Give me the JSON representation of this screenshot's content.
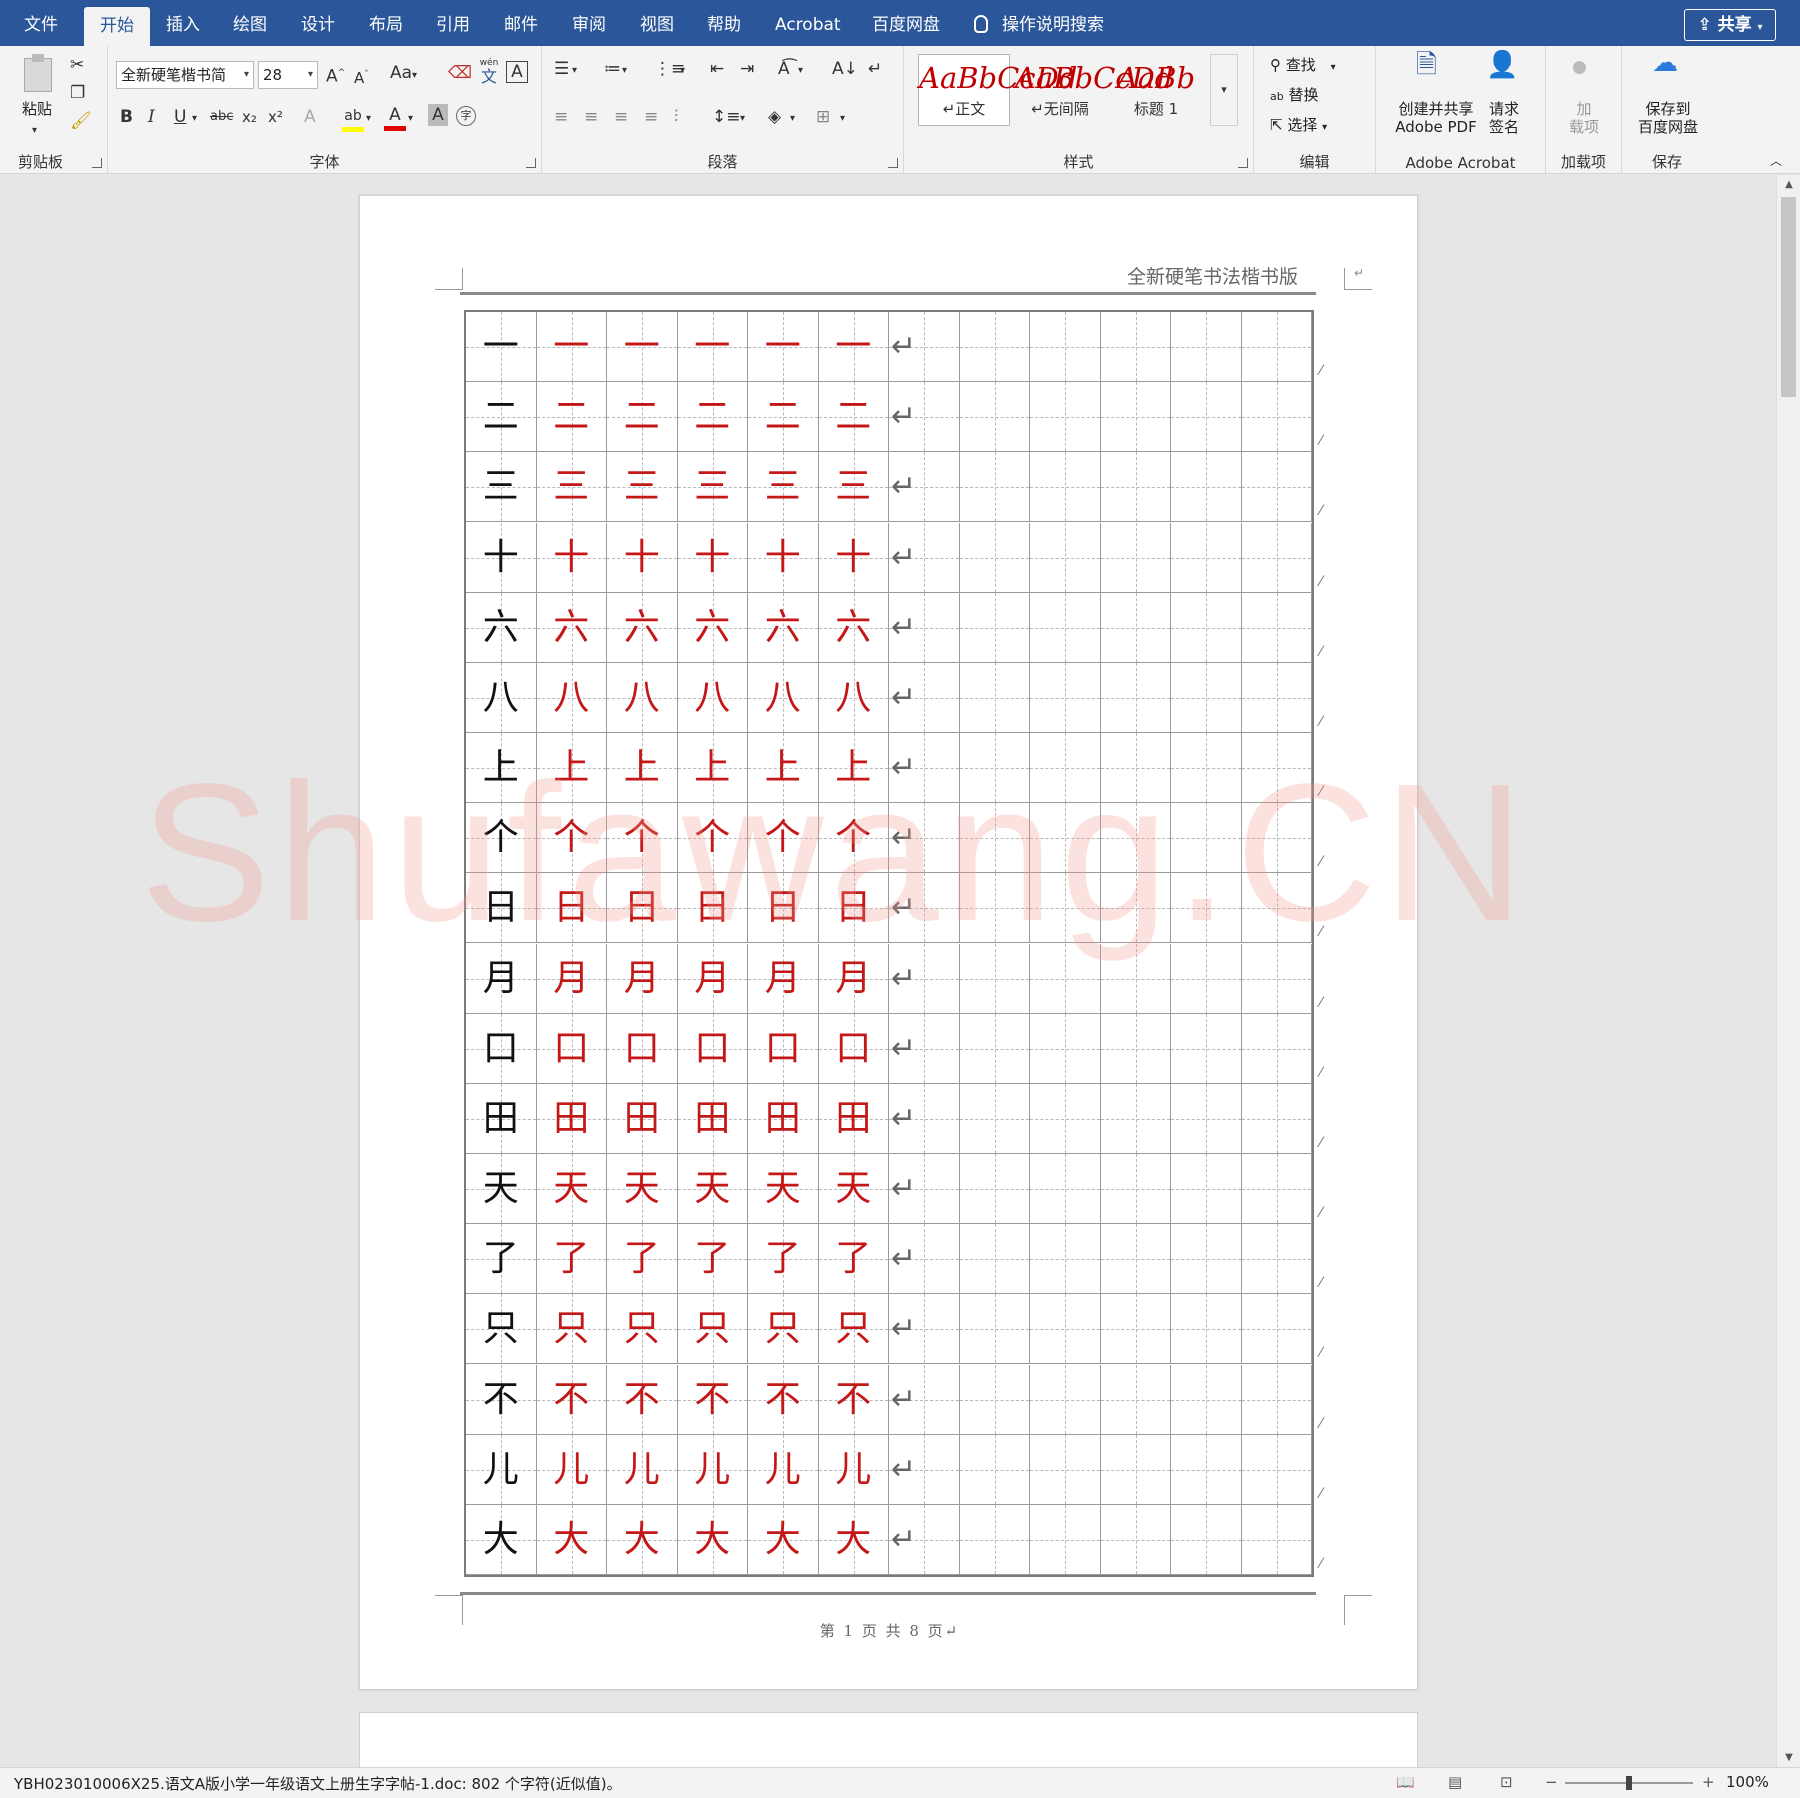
{
  "tabs": [
    "文件",
    "开始",
    "插入",
    "绘图",
    "设计",
    "布局",
    "引用",
    "邮件",
    "审阅",
    "视图",
    "帮助",
    "Acrobat",
    "百度网盘"
  ],
  "tell_me": "操作说明搜索",
  "share_label": "共享",
  "ribbon": {
    "clipboard": {
      "label": "剪贴板",
      "paste": "粘贴"
    },
    "font": {
      "label": "字体",
      "font_name": "全新硬笔楷书简",
      "font_size": "28",
      "case_label": "Aa",
      "pinyin_top": "wén",
      "pinyin_char": "文",
      "bold": "B",
      "italic": "I",
      "underline": "U",
      "strike": "abc",
      "sub": "x₂",
      "sup": "x²",
      "font_color": "A",
      "char_shade": "A",
      "highlight_color": "#ffff00",
      "fontcolor_color": "#e00000"
    },
    "paragraph": {
      "label": "段落"
    },
    "styles": {
      "label": "样式",
      "items": [
        {
          "sample": "AaBbCcDd",
          "name": "↵正文"
        },
        {
          "sample": "AaBbCcDd",
          "name": "↵无间隔"
        },
        {
          "sample": "AaBb",
          "name": "标题 1"
        }
      ]
    },
    "editing": {
      "label": "编辑",
      "find": "查找",
      "replace": "替换",
      "select": "选择"
    },
    "acrobat": {
      "label": "Adobe Acrobat",
      "create_line1": "创建并共享",
      "create_line2": "Adobe PDF",
      "sign_line1": "请求",
      "sign_line2": "签名"
    },
    "addins": {
      "label": "加载项",
      "btn_line1": "加",
      "btn_line2": "载项"
    },
    "save": {
      "label": "保存",
      "btn_line1": "保存到",
      "btn_line2": "百度网盘"
    }
  },
  "document": {
    "header": "全新硬笔书法楷书版",
    "footer": "第 1 页 共 8 页↵",
    "characters": [
      "一",
      "二",
      "三",
      "十",
      "六",
      "八",
      "上",
      "个",
      "日",
      "月",
      "口",
      "田",
      "天",
      "了",
      "只",
      "不",
      "儿",
      "大"
    ],
    "traces_per_row": 5,
    "grid_columns": 12,
    "return_mark": "↵",
    "watermark": "Shufawang.CN"
  },
  "status": {
    "text": "YBH023010006X25.语文A版小学一年级语文上册生字字帖-1.doc: 802 个字符(近似值)。",
    "zoom": "100%",
    "zoom_minus": "−",
    "zoom_plus": "+",
    "zoom_level": 0.5
  },
  "colors": {
    "accent": "#2b579a",
    "model_char": "#111111",
    "trace_char": "#c41818"
  }
}
